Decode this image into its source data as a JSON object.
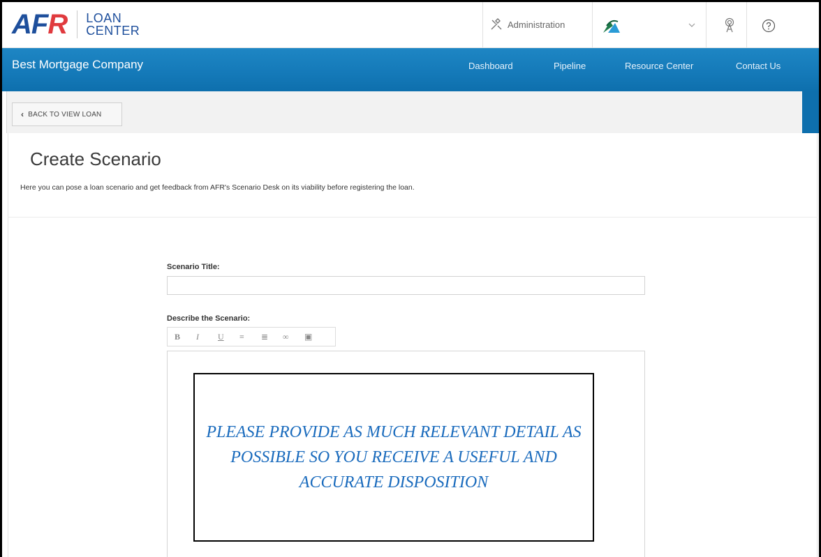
{
  "logo": {
    "brand_prefix": "AF",
    "brand_suffix": "R",
    "line1": "LOAN",
    "line2": "CENTER"
  },
  "header": {
    "administration_label": "Administration",
    "company_icon": "company-logo-icon",
    "dropdown_icon": "chevron-down-icon",
    "notification_icon": "broadcast-icon",
    "help_icon": "help-circle-icon"
  },
  "nav": {
    "company": "Best Mortgage Company",
    "links": [
      "Dashboard",
      "Pipeline",
      "Resource Center",
      "Contact Us"
    ]
  },
  "back_button": {
    "label": "BACK TO VIEW LOAN"
  },
  "page": {
    "title": "Create Scenario",
    "description": "Here you can pose a loan scenario and get feedback from AFR's Scenario Desk on its viability before registering the loan."
  },
  "form": {
    "title_label": "Scenario Title:",
    "title_value": "",
    "describe_label": "Describe the Scenario:",
    "toolbar": [
      "B",
      "I",
      "U",
      "bulleted-list",
      "numbered-list",
      "link",
      "image"
    ],
    "toolbar_glyphs": [
      "B",
      "I",
      "U",
      "≡",
      "≣",
      "∞",
      "▣"
    ]
  },
  "callout": {
    "text": "PLEASE PROVIDE AS MUCH RELEVANT DETAIL AS POSSIBLE SO YOU RECEIVE A USEFUL AND ACCURATE DISPOSITION"
  },
  "colors": {
    "nav_bg": "#1479b8",
    "brand_blue": "#1e4f9c",
    "brand_red": "#e03a3e",
    "callout_text": "#1a6bbd"
  }
}
